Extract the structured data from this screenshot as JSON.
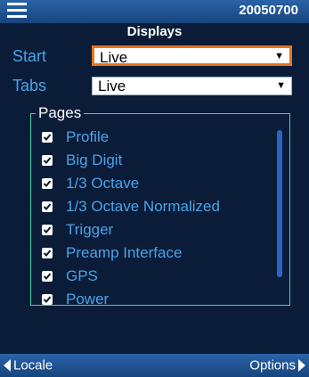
{
  "header": {
    "device_id": "20050700",
    "menu_icon": "hamburger-menu-icon"
  },
  "screen": {
    "title": "Displays"
  },
  "start": {
    "label": "Start",
    "value": "Live"
  },
  "tabs": {
    "label": "Tabs",
    "value": "Live"
  },
  "pages": {
    "legend": "Pages",
    "items": [
      {
        "label": "Profile",
        "checked": true
      },
      {
        "label": "Big Digit",
        "checked": true
      },
      {
        "label": "1/3 Octave",
        "checked": true
      },
      {
        "label": "1/3 Octave Normalized",
        "checked": true
      },
      {
        "label": "Trigger",
        "checked": true
      },
      {
        "label": "Preamp Interface",
        "checked": true
      },
      {
        "label": "GPS",
        "checked": true
      },
      {
        "label": "Power",
        "checked": true
      }
    ]
  },
  "footer": {
    "left_label": "Locale",
    "right_label": "Options"
  },
  "colors": {
    "background": "#0a1c38",
    "bar": "#17457e",
    "label_blue": "#4aa3e8",
    "focus_border": "#e8731d",
    "group_border": "#3ad6b0",
    "scrollbar": "#2d63c2"
  }
}
